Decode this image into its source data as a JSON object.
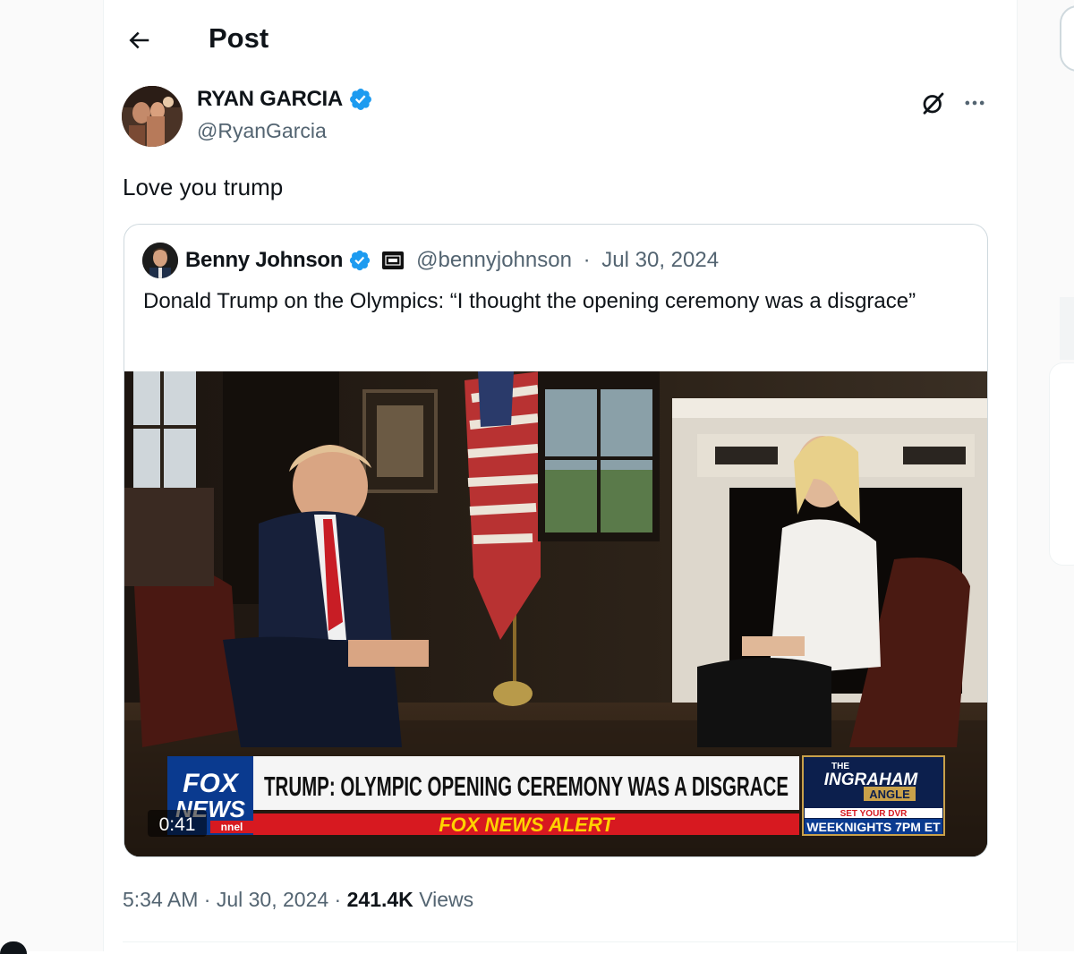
{
  "header": {
    "title": "Post"
  },
  "post": {
    "author_name": "RYAN GARCIA",
    "author_handle": "@RyanGarcia",
    "text": "Love you trump",
    "time": "5:34 AM",
    "date": "Jul 30, 2024",
    "views_count": "241.4K",
    "views_label": "Views"
  },
  "quote": {
    "author_name": "Benny Johnson",
    "author_handle": "@bennyjohnson",
    "date": "Jul 30, 2024",
    "text": "Donald Trump on the Olympics: “I thought the opening ceremony was a disgrace”"
  },
  "video": {
    "duration": "0:41",
    "headline": "TRUMP: OLYMPIC OPENING CEREMONY WAS A DISGRACE",
    "alert": "FOX NEWS ALERT",
    "network_line1": "FOX",
    "network_line2": "NEWS",
    "network_line3": "nnel",
    "show_small": "THE",
    "show_name": "INGRAHAM",
    "show_sub": "ANGLE",
    "show_promo": "SET YOUR DVR",
    "show_schedule": "WEEKNIGHTS 7PM ET"
  },
  "colors": {
    "verified": "#1d9bf0",
    "muted_text": "#536471",
    "fox_red": "#d71920",
    "fox_blue": "#0a3a8f"
  },
  "icons": [
    "back-arrow-icon",
    "verified-badge-icon",
    "grok-icon",
    "more-icon",
    "affiliate-badge-icon"
  ]
}
